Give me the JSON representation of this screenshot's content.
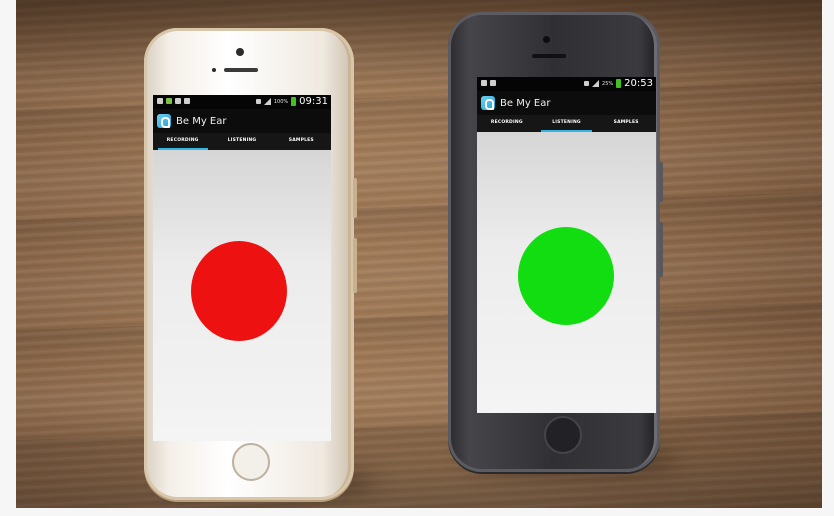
{
  "phones": [
    {
      "finish": "gold",
      "status_time": "09:31",
      "battery_pct": "100%",
      "app_title": "Be My Ear",
      "tabs": [
        "RECORDING",
        "LISTENING",
        "SAMPLES"
      ],
      "selected_tab": "RECORDING",
      "indicator_color": "#ee1111"
    },
    {
      "finish": "space-gray",
      "status_time": "20:53",
      "battery_pct": "25%",
      "app_title": "Be My Ear",
      "tabs": [
        "RECORDING",
        "LISTENING",
        "SAMPLES"
      ],
      "selected_tab": "LISTENING",
      "indicator_color": "#11dd11"
    }
  ],
  "colors": {
    "tab_indicator": "#33b5e5",
    "recording_circle": "#ee1111",
    "listening_circle": "#11dd11"
  }
}
